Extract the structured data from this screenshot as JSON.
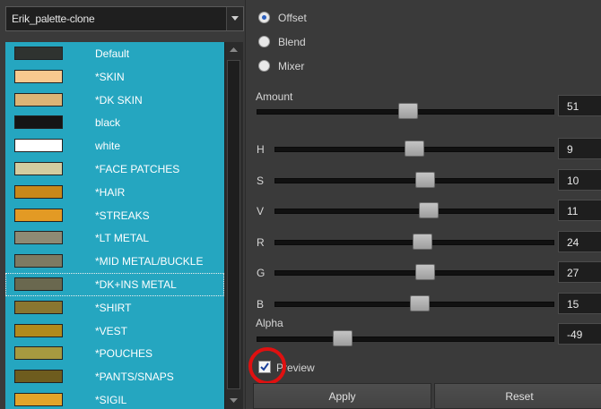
{
  "palette_select": {
    "value": "Erik_palette-clone"
  },
  "swatches": [
    {
      "label": "Default",
      "color": "#2f3330"
    },
    {
      "label": "*SKIN",
      "color": "#f8c98f"
    },
    {
      "label": "*DK SKIN",
      "color": "#dcb476"
    },
    {
      "label": "black",
      "color": "#151515"
    },
    {
      "label": "white",
      "color": "#ffffff"
    },
    {
      "label": "*FACE PATCHES",
      "color": "#d3cca0"
    },
    {
      "label": "*HAIR",
      "color": "#c8881a"
    },
    {
      "label": "*STREAKS",
      "color": "#e39a24"
    },
    {
      "label": "*LT METAL",
      "color": "#8e8a74"
    },
    {
      "label": "*MID METAL/BUCKLE",
      "color": "#7d7a62"
    },
    {
      "label": "*DK+INS METAL",
      "color": "#6a684f"
    },
    {
      "label": "*SHIRT",
      "color": "#8a7630"
    },
    {
      "label": "*VEST",
      "color": "#b28a1c"
    },
    {
      "label": "*POUCHES",
      "color": "#a69a40"
    },
    {
      "label": "*PANTS/SNAPS",
      "color": "#6e5c1e"
    },
    {
      "label": "*SIGIL",
      "color": "#e3a42a"
    }
  ],
  "mode": {
    "options": [
      "Offset",
      "Blend",
      "Mixer"
    ],
    "selected": "Offset"
  },
  "amount": {
    "label": "Amount",
    "value": "51",
    "level": 0.51
  },
  "channels": [
    {
      "label": "H",
      "value": "9",
      "level": 0.5
    },
    {
      "label": "S",
      "value": "10",
      "level": 0.54
    },
    {
      "label": "V",
      "value": "11",
      "level": 0.55
    },
    {
      "label": "R",
      "value": "24",
      "level": 0.53
    },
    {
      "label": "G",
      "value": "27",
      "level": 0.54
    },
    {
      "label": "B",
      "value": "15",
      "level": 0.52
    }
  ],
  "alpha": {
    "label": "Alpha",
    "value": "-49",
    "level": 0.29
  },
  "preview": {
    "label": "Preview",
    "checked": true
  },
  "buttons": {
    "apply": "Apply",
    "reset": "Reset"
  },
  "colors": {
    "list_background": "#25a6c0",
    "highlight_circle": "#e01010",
    "panel_background": "#3a3a3a"
  }
}
